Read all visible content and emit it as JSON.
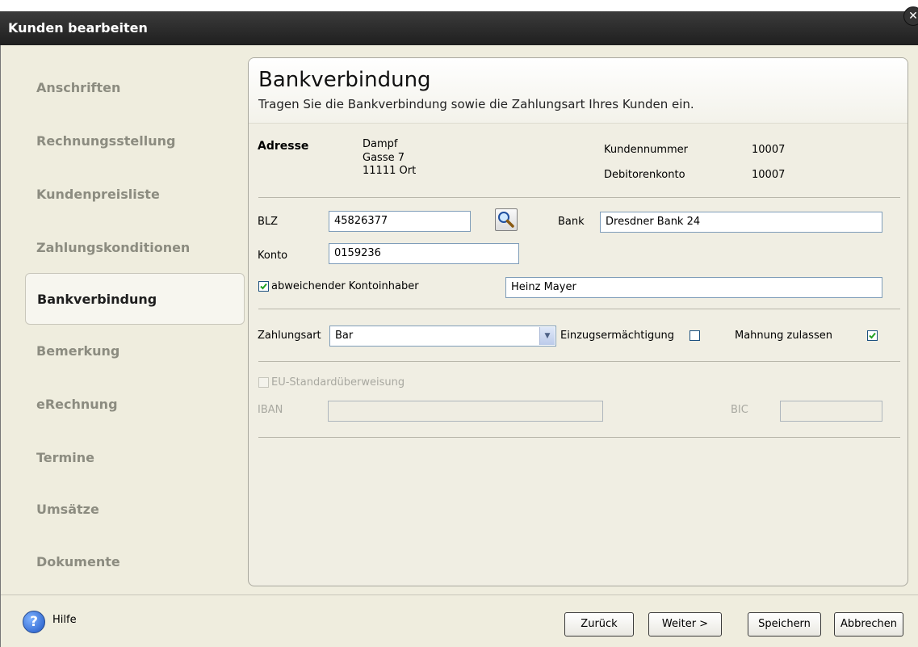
{
  "window": {
    "title": "Kunden bearbeiten",
    "close_glyph": "✕"
  },
  "sidebar": {
    "items": [
      {
        "label": "Anschriften",
        "active": false
      },
      {
        "label": "Rechnungsstellung",
        "active": false
      },
      {
        "label": "Kundenpreisliste",
        "active": false
      },
      {
        "label": "Zahlungskonditionen",
        "active": false
      },
      {
        "label": "Bankverbindung",
        "active": true
      },
      {
        "label": "Bemerkung",
        "active": false
      },
      {
        "label": "eRechnung",
        "active": false
      },
      {
        "label": "Termine",
        "active": false
      },
      {
        "label": "Umsätze",
        "active": false
      },
      {
        "label": "Dokumente",
        "active": false
      }
    ]
  },
  "panel": {
    "title": "Bankverbindung",
    "subtitle": "Tragen Sie die Bankverbindung sowie die Zahlungsart Ihres Kunden ein."
  },
  "address": {
    "label": "Adresse",
    "line1": "Dampf",
    "line2": "Gasse 7",
    "line3": "11111 Ort",
    "kundennummer_label": "Kundennummer",
    "kundennummer_value": "10007",
    "debitorenkonto_label": "Debitorenkonto",
    "debitorenkonto_value": "10007"
  },
  "bank": {
    "blz_label": "BLZ",
    "blz_value": "45826377",
    "bank_label": "Bank",
    "bank_value": "Dresdner Bank 24",
    "konto_label": "Konto",
    "konto_value": "0159236",
    "abweichender_label": "abweichender Kontoinhaber",
    "abweichender_checked": true,
    "kontoinhaber_value": "Heinz Mayer"
  },
  "payment": {
    "zahlungsart_label": "Zahlungsart",
    "zahlungsart_value": "Bar",
    "einzug_label": "Einzugsermächtigung",
    "einzug_checked": false,
    "mahnung_label": "Mahnung zulassen",
    "mahnung_checked": true
  },
  "sepa": {
    "eu_label": "EU-Standardüberweisung",
    "eu_checked": false,
    "iban_label": "IBAN",
    "iban_value": "",
    "bic_label": "BIC",
    "bic_value": ""
  },
  "footer": {
    "help_glyph": "?",
    "help_label": "Hilfe",
    "back_label": "Zurück",
    "next_label": "Weiter >",
    "save_label": "Speichern",
    "cancel_label": "Abbrechen"
  },
  "colors": {
    "titlebar": "#2b2b2b",
    "window_bg": "#efedde",
    "input_border": "#7f9db9",
    "check_green": "#21a121"
  },
  "icons": {
    "search": "magnifier-icon",
    "help": "help-icon",
    "dropdown": "chevron-down-icon",
    "close": "close-icon"
  }
}
